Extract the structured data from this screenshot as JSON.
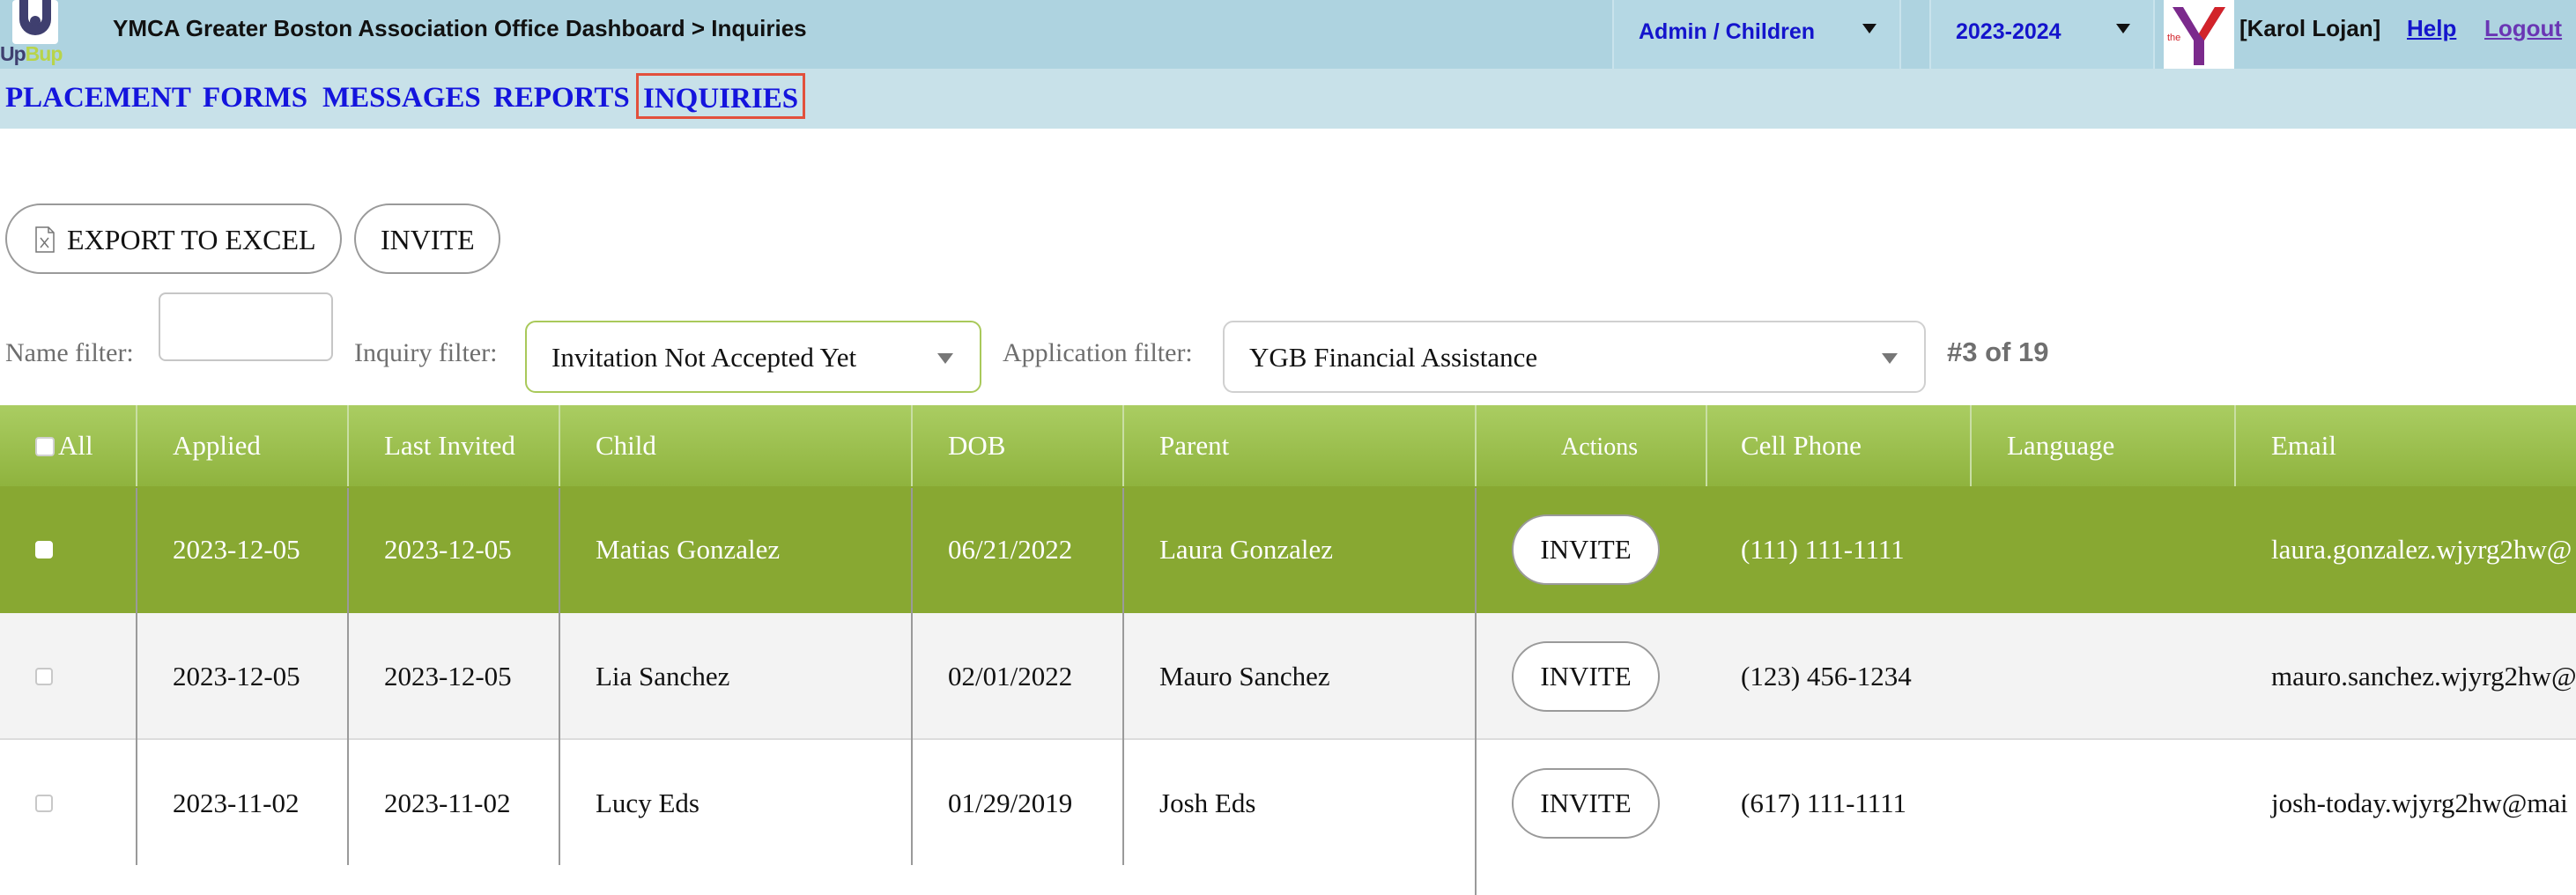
{
  "header": {
    "logo_text_part1": "Up",
    "logo_text_part2": "Bup",
    "title": "YMCA Greater Boston Association Office Dashboard > Inquiries",
    "role_select": "Admin / Children",
    "year_select": "2023-2024",
    "org_logo_text": "the",
    "user": "[Karol Lojan]",
    "help": "Help",
    "logout": "Logout",
    "colors": {
      "bar": "#aed3e0",
      "link": "#1414cc",
      "logout": "#6a36b4"
    }
  },
  "nav": {
    "items": [
      "PLACEMENT",
      "FORMS",
      "MESSAGES",
      "REPORTS",
      "INQUIRIES"
    ],
    "active": "INQUIRIES"
  },
  "toolbar": {
    "export_label": "EXPORT TO EXCEL",
    "export_icon": "excel-file-icon",
    "invite_label": "INVITE"
  },
  "filters": {
    "name_label": "Name filter:",
    "name_value": "",
    "inquiry_label": "Inquiry filter:",
    "inquiry_value": "Invitation Not Accepted Yet",
    "application_label": "Application filter:",
    "application_value": "YGB Financial Assistance",
    "record_count": "#3 of 19"
  },
  "table": {
    "columns": [
      "All",
      "Applied",
      "Last Invited",
      "Child",
      "DOB",
      "Parent",
      "Actions",
      "Cell Phone",
      "Language",
      "Email"
    ],
    "header_color": "#9fc252",
    "selected_row_color": "#88a832",
    "rows": [
      {
        "applied": "2023-12-05",
        "last_invited": "2023-12-05",
        "child": "Matias Gonzalez",
        "dob": "06/21/2022",
        "parent": "Laura Gonzalez",
        "action": "INVITE",
        "cell": "(111) 111-1111",
        "language": "",
        "email": "laura.gonzalez.wjyrg2hw@",
        "selected": true
      },
      {
        "applied": "2023-12-05",
        "last_invited": "2023-12-05",
        "child": "Lia Sanchez",
        "dob": "02/01/2022",
        "parent": "Mauro Sanchez",
        "action": "INVITE",
        "cell": "(123) 456-1234",
        "language": "",
        "email": "mauro.sanchez.wjyrg2hw@",
        "selected": false
      },
      {
        "applied": "2023-11-02",
        "last_invited": "2023-11-02",
        "child": "Lucy Eds",
        "dob": "01/29/2019",
        "parent": "Josh Eds",
        "action": "INVITE",
        "cell": "(617) 111-1111",
        "language": "",
        "email": "josh-today.wjyrg2hw@mai",
        "selected": false
      }
    ]
  }
}
